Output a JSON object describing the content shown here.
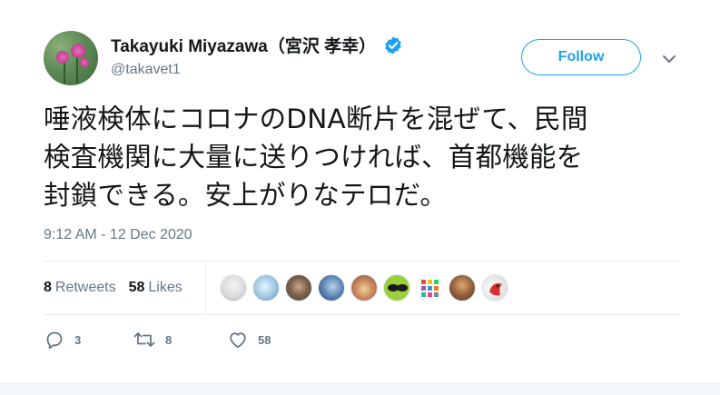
{
  "author": {
    "display_name": "Takayuki Miyazawa（宮沢 孝幸）",
    "handle": "@takavet1",
    "verified": true
  },
  "follow_button": {
    "label": "Follow"
  },
  "tweet": {
    "text_lines": [
      "唾液検体にコロナのDNA断片を混ぜて、民間",
      "検査機関に大量に送りつければ、首都機能を",
      "封鎖できる。安上がりなテロだ。"
    ],
    "timestamp": "9:12 AM - 12 Dec 2020"
  },
  "stats": {
    "retweets_count": "8",
    "retweets_label": "Retweets",
    "likes_count": "58",
    "likes_label": "Likes",
    "liker_avatars": 9
  },
  "actions": {
    "reply_count": "3",
    "retweet_count": "8",
    "like_count": "58"
  },
  "colors": {
    "accent": "#1da1f2",
    "text_primary": "#14171a",
    "text_secondary": "#657786",
    "divider": "#e6ecf0"
  },
  "icons": [
    "verified-icon",
    "chevron-down-icon",
    "reply-icon",
    "retweet-icon",
    "like-icon"
  ]
}
